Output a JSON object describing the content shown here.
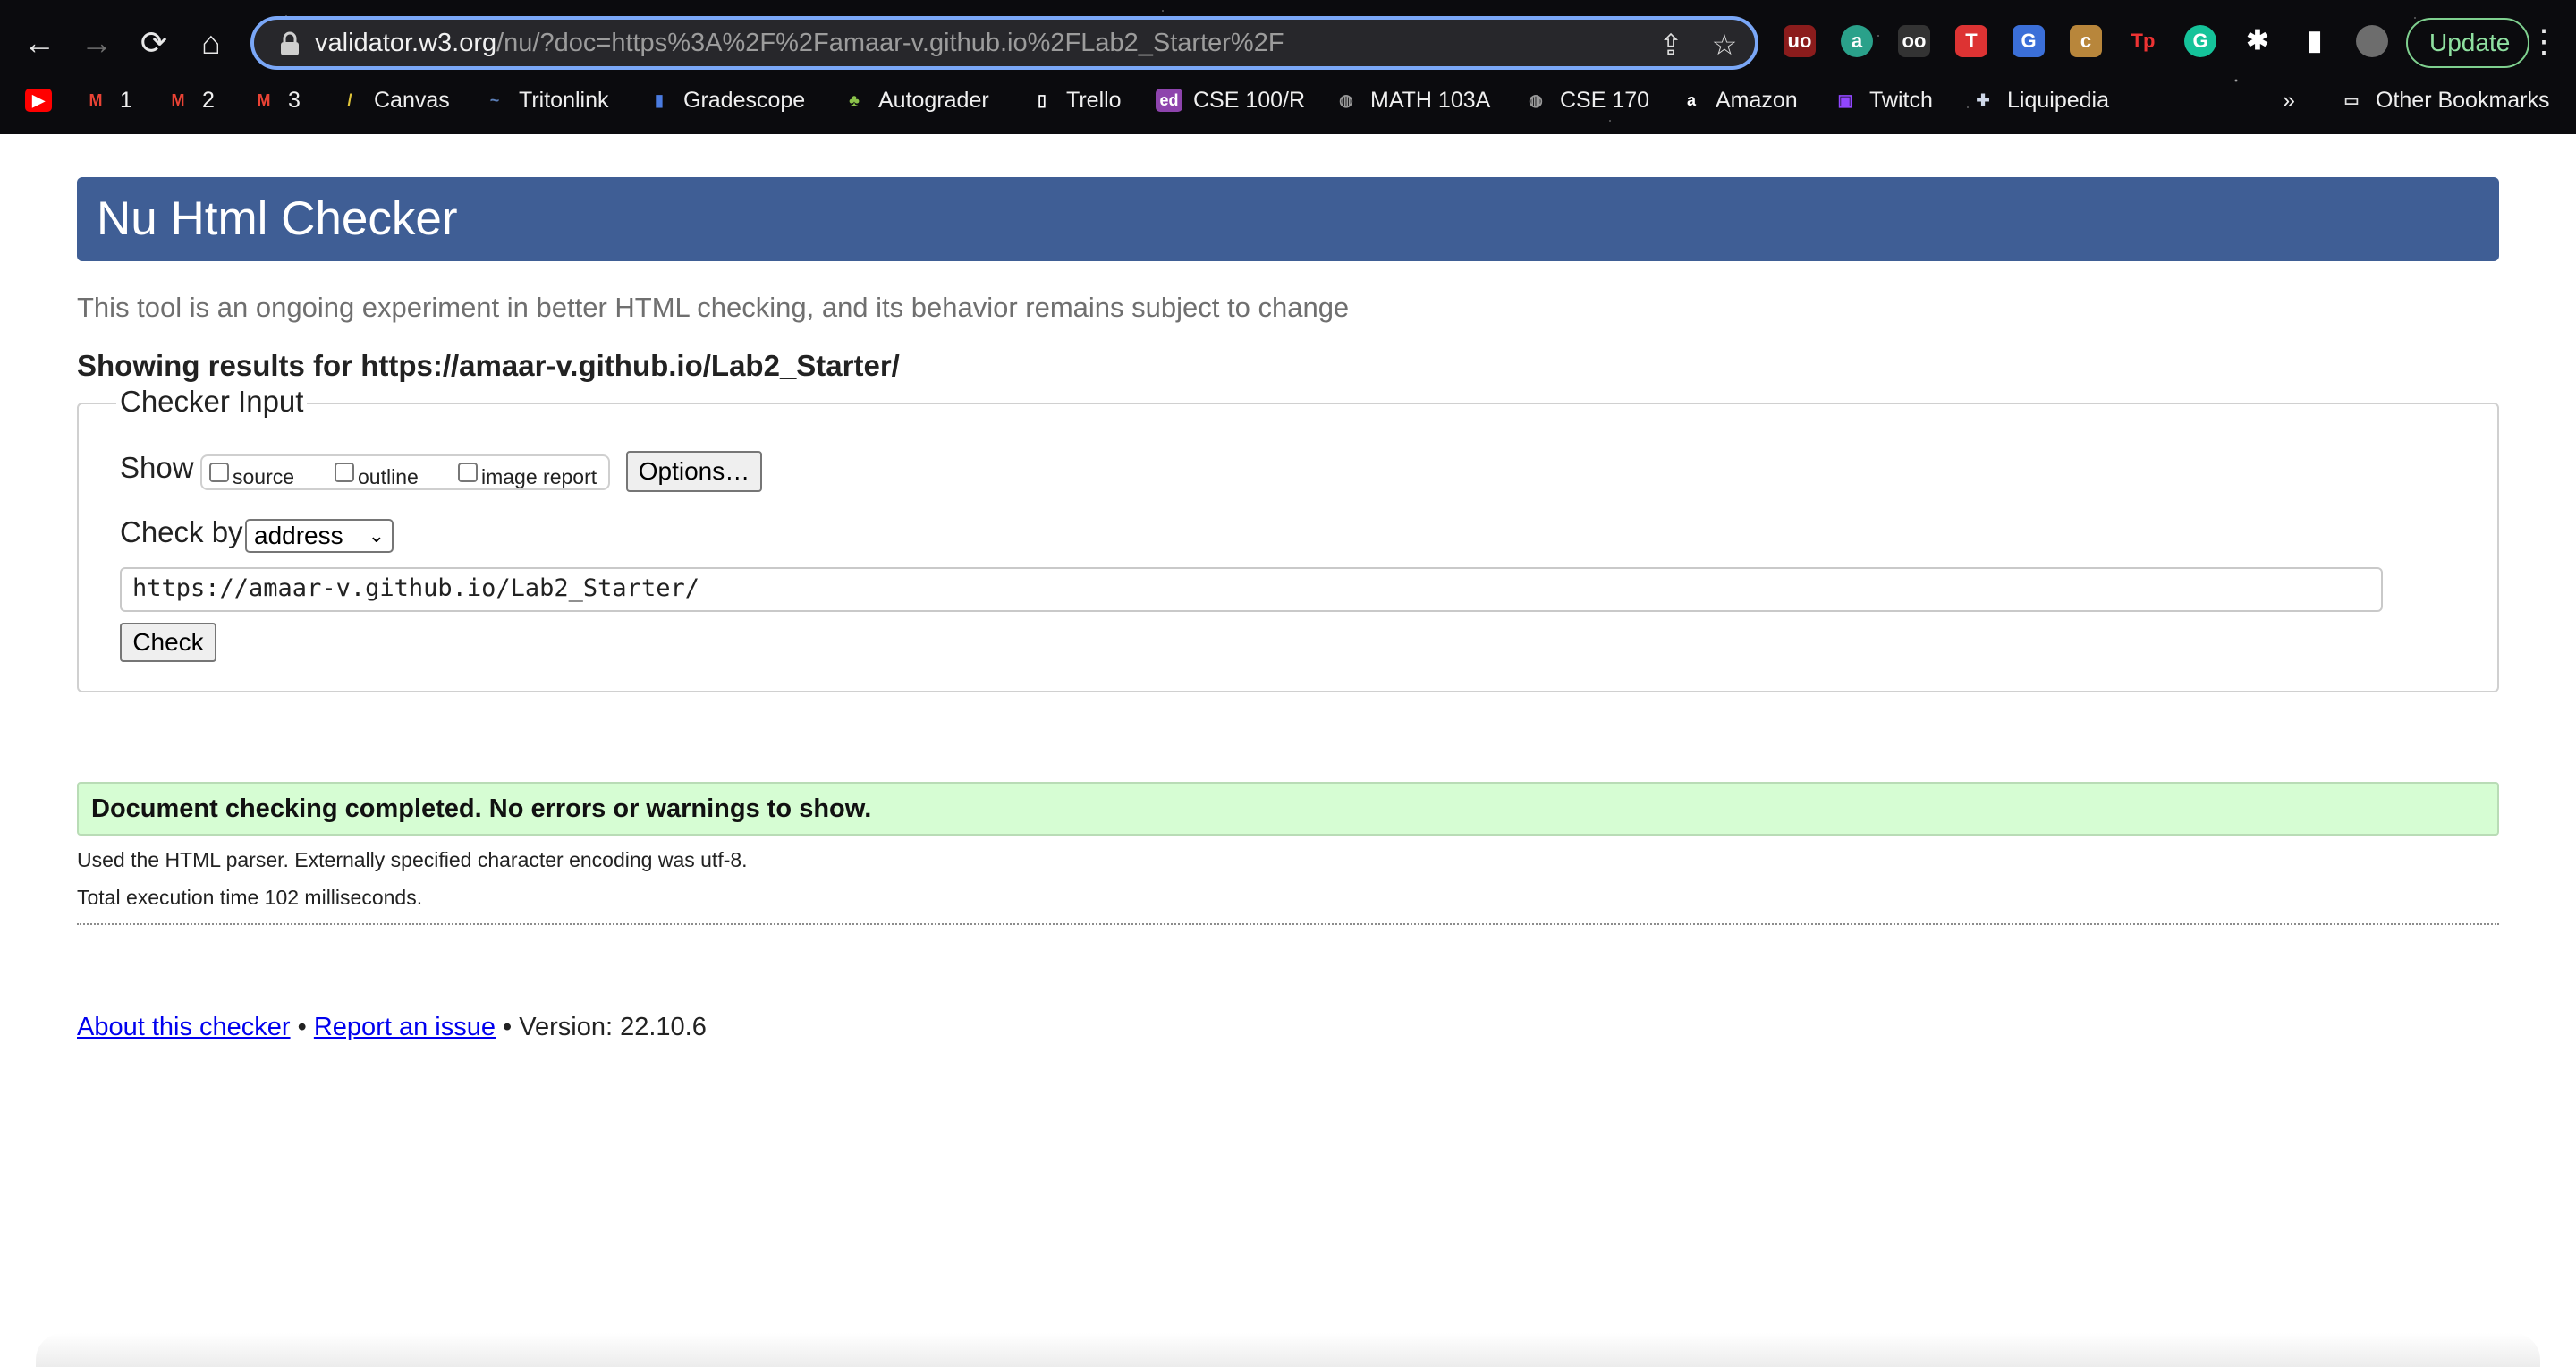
{
  "browser": {
    "url_host": "validator.w3.org",
    "url_path": "/nu/?doc=https%3A%2F%2Famaar-v.github.io%2FLab2_Starter%2F",
    "update_label": "Update",
    "bookmarks": [
      {
        "label": "",
        "icon": "youtube-icon",
        "color": "#ff0000"
      },
      {
        "label": "1",
        "icon": "gmail-icon",
        "color": "#ea4335"
      },
      {
        "label": "2",
        "icon": "gmail-icon",
        "color": "#ea4335"
      },
      {
        "label": "3",
        "icon": "gmail-icon",
        "color": "#ea4335"
      },
      {
        "label": "Canvas",
        "icon": "canvas-icon",
        "color": "#e0c53a"
      },
      {
        "label": "Tritonlink",
        "icon": "triton-icon",
        "color": "#5c7fb8"
      },
      {
        "label": "Gradescope",
        "icon": "gradescope-icon",
        "color": "#4a7be0"
      },
      {
        "label": "Autograder",
        "icon": "bonsai-icon",
        "color": "#8bc34a"
      },
      {
        "label": "Trello",
        "icon": "trello-icon",
        "color": "#ffffff"
      },
      {
        "label": "CSE 100/R",
        "icon": "ed-icon",
        "color": "#8e44ad"
      },
      {
        "label": "MATH 103A",
        "icon": "globe-icon",
        "color": "#9a9a9a"
      },
      {
        "label": "CSE 170",
        "icon": "globe-icon",
        "color": "#9a9a9a"
      },
      {
        "label": "Amazon",
        "icon": "amazon-icon",
        "color": "#ffffff"
      },
      {
        "label": "Twitch",
        "icon": "twitch-icon",
        "color": "#9146ff"
      },
      {
        "label": "Liquipedia",
        "icon": "liquipedia-icon",
        "color": "#cfd8e8"
      }
    ],
    "other_bookmarks": "Other Bookmarks",
    "overflow": "»"
  },
  "page": {
    "title": "Nu Html Checker",
    "tagline": "This tool is an ongoing experiment in better HTML checking, and its behavior remains subject to change",
    "showing": "Showing results for https://amaar-v.github.io/Lab2_Starter/",
    "checker": {
      "legend": "Checker Input",
      "show_label": "Show",
      "options": [
        "source",
        "outline",
        "image report"
      ],
      "options_button": "Options…",
      "check_by_label": "Check by",
      "check_by_value": "address",
      "url_value": "https://amaar-v.github.io/Lab2_Starter/",
      "check_button": "Check"
    },
    "result": "Document checking completed. No errors or warnings to show.",
    "details": [
      "Used the HTML parser. Externally specified character encoding was utf-8.",
      "Total execution time 102 milliseconds."
    ],
    "footer": {
      "about": "About this checker",
      "sep1": " • ",
      "report": "Report an issue",
      "version": " • Version: 22.10.6"
    }
  }
}
